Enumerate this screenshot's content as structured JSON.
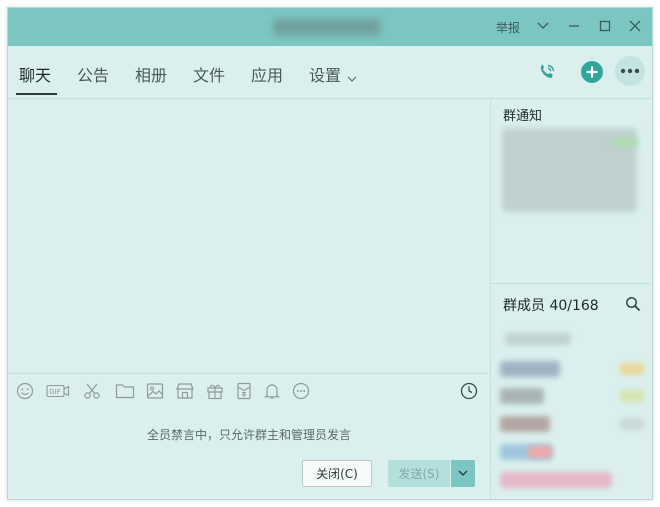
{
  "titlebar": {
    "report_label": "举报",
    "icons": [
      "chevron-down-icon",
      "minimize-icon",
      "maximize-icon",
      "close-icon"
    ]
  },
  "tabs": [
    {
      "label": "聊天",
      "active": true
    },
    {
      "label": "公告",
      "active": false
    },
    {
      "label": "相册",
      "active": false
    },
    {
      "label": "文件",
      "active": false
    },
    {
      "label": "应用",
      "active": false
    },
    {
      "label": "设置",
      "active": false
    }
  ],
  "header_actions": [
    "phone-call-icon",
    "add-icon",
    "more-icon"
  ],
  "toolbar_icons": [
    "emoji-icon",
    "gif-icon",
    "screenshot-scissors-icon",
    "folder-icon",
    "image-icon",
    "shop-icon",
    "gift-icon",
    "red-packet-icon",
    "bell-icon",
    "more-circle-icon",
    "history-clock-icon"
  ],
  "composer": {
    "mute_notice": "全员禁言中，只允许群主和管理员发言",
    "close_button": "关闭(C)",
    "send_button": "发送(S)"
  },
  "sidebar": {
    "notice_title": "群通知",
    "members_title": "群成员 40/168"
  },
  "colors": {
    "titlebar": "#7cc6c1",
    "background": "#dbf0ee",
    "accent": "#2fa79b"
  }
}
